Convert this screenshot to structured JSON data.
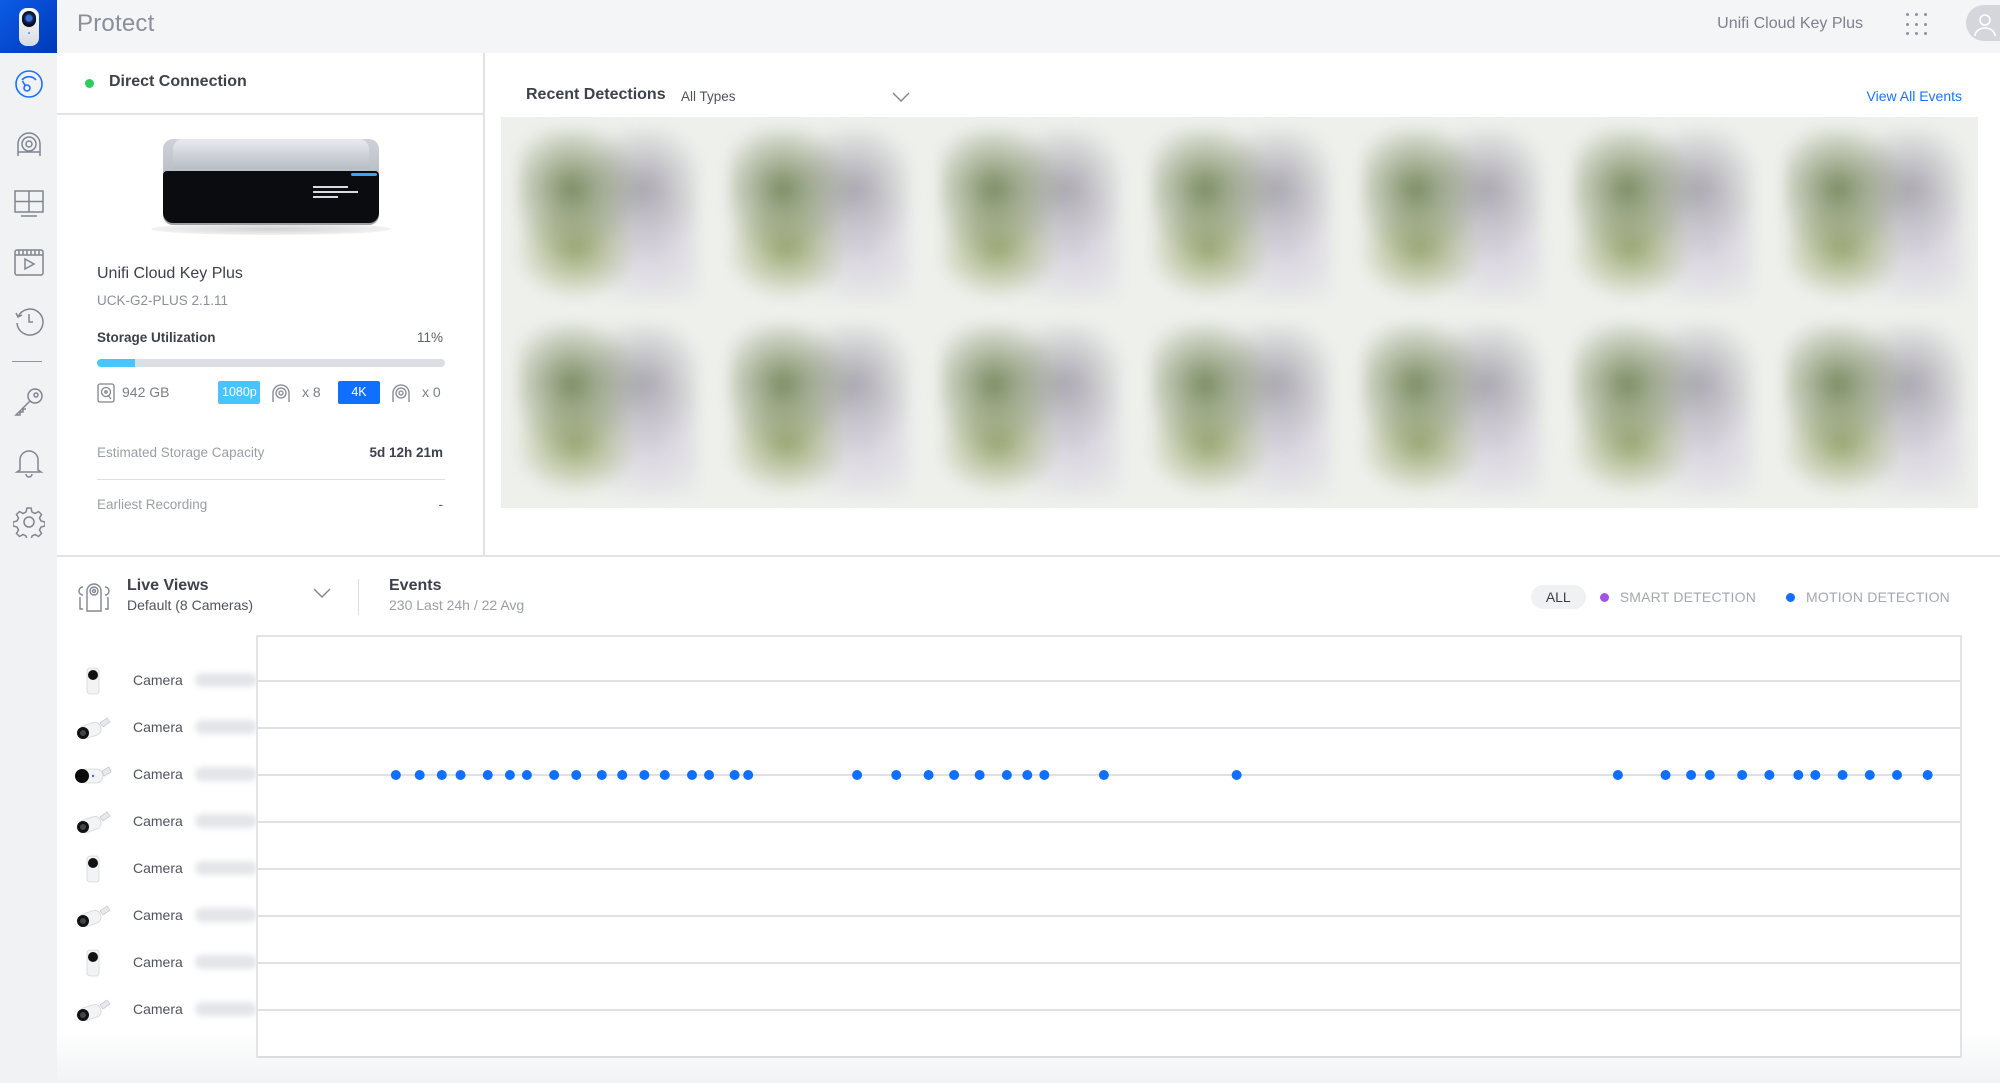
{
  "header": {
    "app_title": "Protect",
    "device_name": "Unifi Cloud Key Plus",
    "apps_icon": "apps-grid-icon",
    "avatar_icon": "user-icon"
  },
  "sidebar": {
    "logo_icon": "camera-logo-icon",
    "items": [
      {
        "id": "dashboard",
        "icon": "dashboard-gauge-icon",
        "active": true
      },
      {
        "id": "devices",
        "icon": "camera-icon",
        "active": false
      },
      {
        "id": "liveview",
        "icon": "grid-icon",
        "active": false
      },
      {
        "id": "recordings",
        "icon": "video-clip-icon",
        "active": false
      },
      {
        "id": "timelapse",
        "icon": "history-icon",
        "active": false
      },
      {
        "id": "users",
        "icon": "key-icon",
        "active": false
      },
      {
        "id": "alerts",
        "icon": "bell-icon",
        "active": false
      },
      {
        "id": "settings",
        "icon": "gear-icon",
        "active": false
      }
    ]
  },
  "device_panel": {
    "connection_status": "Direct Connection",
    "connection_color": "#2ecc5c",
    "device_title": "Unifi Cloud Key Plus",
    "device_model": "UCK-G2-PLUS 2.1.11",
    "storage_label": "Storage Utilization",
    "storage_percent_text": "11%",
    "storage_percent": 11,
    "disk_size": "942 GB",
    "res_1080_label": "1080p",
    "res_1080_count": "x 8",
    "res_4k_label": "4K",
    "res_4k_count": "x 0",
    "estimated_label": "Estimated Storage Capacity",
    "estimated_value": "5d 12h 21m",
    "earliest_label": "Earliest Recording",
    "earliest_value": "-"
  },
  "detections": {
    "title": "Recent Detections",
    "filter_value": "All Types",
    "view_all_label": "View All Events",
    "thumbnail_count": 14
  },
  "live_views": {
    "title": "Live Views",
    "subtitle": "Default (8 Cameras)"
  },
  "events": {
    "title": "Events",
    "subtitle": "230 Last 24h / 22 Avg",
    "filter_all": "ALL",
    "filters": [
      {
        "label": "SMART DETECTION",
        "color": "#a053e6"
      },
      {
        "label": "MOTION DETECTION",
        "color": "#0f6fff"
      }
    ]
  },
  "cameras": [
    {
      "label": "Camera",
      "type": "dome"
    },
    {
      "label": "Camera",
      "type": "bullet"
    },
    {
      "label": "Camera",
      "type": "bullet-dark"
    },
    {
      "label": "Camera",
      "type": "bullet"
    },
    {
      "label": "Camera",
      "type": "dome"
    },
    {
      "label": "Camera",
      "type": "bullet"
    },
    {
      "label": "Camera",
      "type": "dome"
    },
    {
      "label": "Camera",
      "type": "bullet"
    }
  ],
  "chart_data": {
    "type": "scatter",
    "title": "Events timeline",
    "x_unit": "fraction of timeline (0 = left edge, 1 = right edge)",
    "tick_count": 32,
    "major_tick_every": 3,
    "series": [
      {
        "name": "MOTION DETECTION",
        "color": "#0f6fff",
        "camera_row": 3,
        "x": [
          0.081,
          0.095,
          0.108,
          0.119,
          0.135,
          0.148,
          0.158,
          0.174,
          0.187,
          0.202,
          0.214,
          0.227,
          0.239,
          0.255,
          0.265,
          0.28,
          0.288,
          0.352,
          0.375,
          0.394,
          0.409,
          0.424,
          0.44,
          0.452,
          0.462,
          0.497,
          0.575,
          0.799,
          0.827,
          0.842,
          0.853,
          0.872,
          0.888,
          0.905,
          0.915,
          0.931,
          0.947,
          0.963,
          0.981
        ]
      },
      {
        "name": "SMART DETECTION",
        "color": "#a053e6",
        "x": []
      }
    ]
  }
}
